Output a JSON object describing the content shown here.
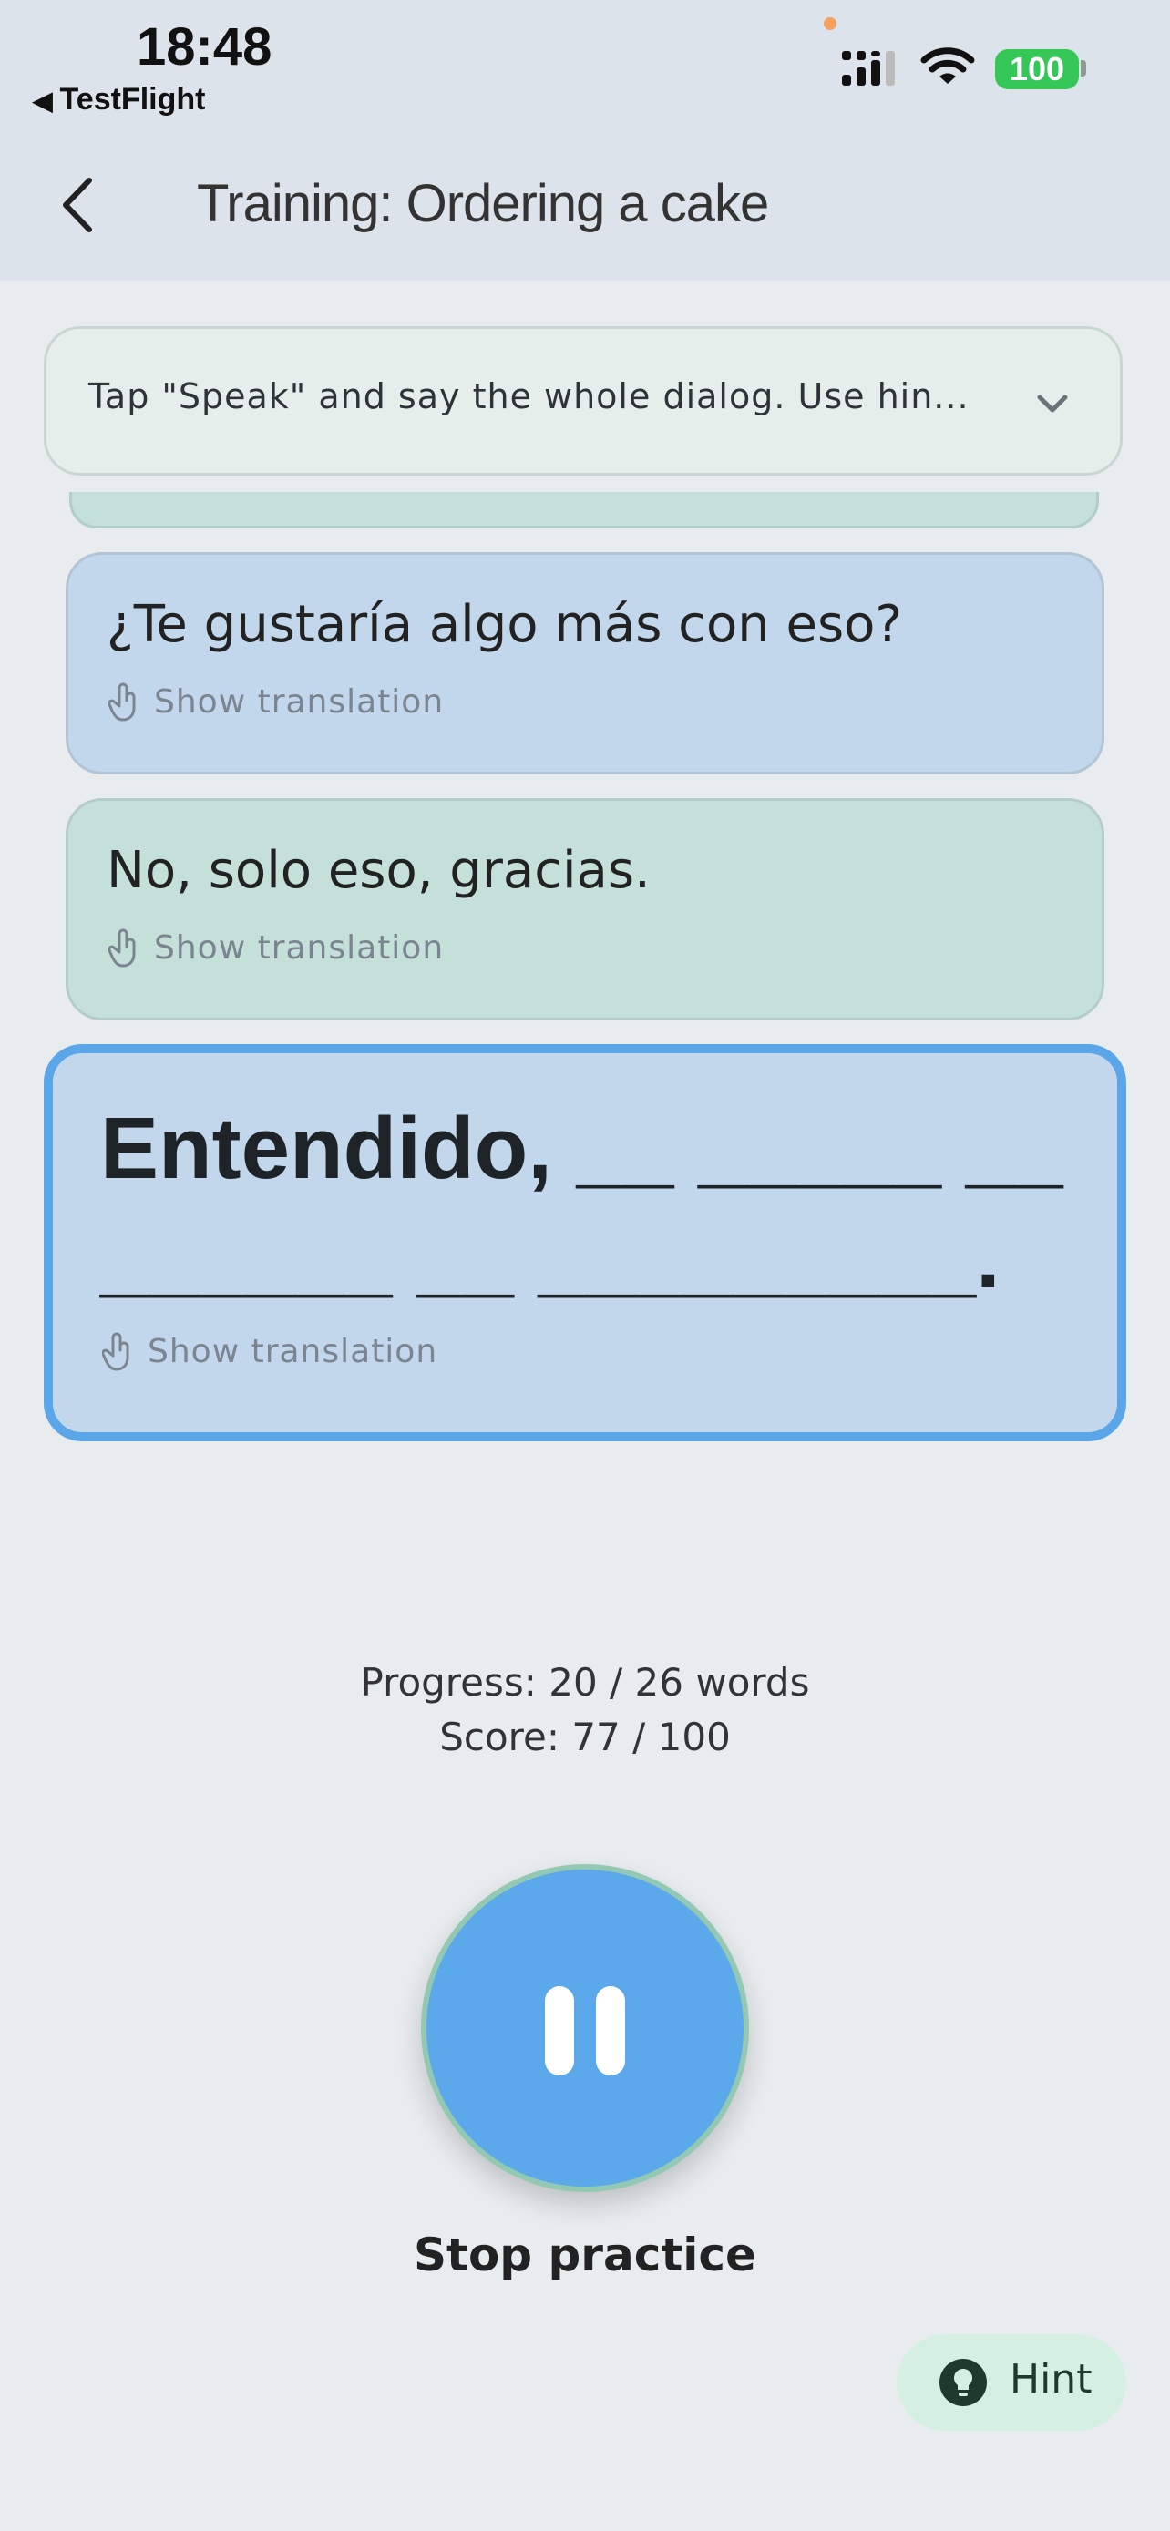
{
  "status_bar": {
    "time": "18:48",
    "back_app": "TestFlight",
    "battery": "100"
  },
  "header": {
    "title": "Training: Ordering a cake"
  },
  "instruction": {
    "text": "Tap \"Speak\" and say the whole dialog. Use hin..."
  },
  "dialog": [
    {
      "text": "¿Te gustaría algo más con eso?",
      "translation_label": "Show translation"
    },
    {
      "text": "No, solo eso, gracias.",
      "translation_label": "Show translation"
    },
    {
      "line1": "Entendido, __ _____ __",
      "line2": "______ __ _________.",
      "translation_label": "Show translation"
    }
  ],
  "stats": {
    "progress": "Progress: 20 / 26 words",
    "score": "Score: 77 / 100"
  },
  "controls": {
    "stop_label": "Stop practice",
    "hint_label": "Hint"
  },
  "colors": {
    "accent": "#5ba8ea",
    "card_blue": "#c2d7ec",
    "card_green": "#c4e0d9",
    "battery": "#36c759"
  }
}
